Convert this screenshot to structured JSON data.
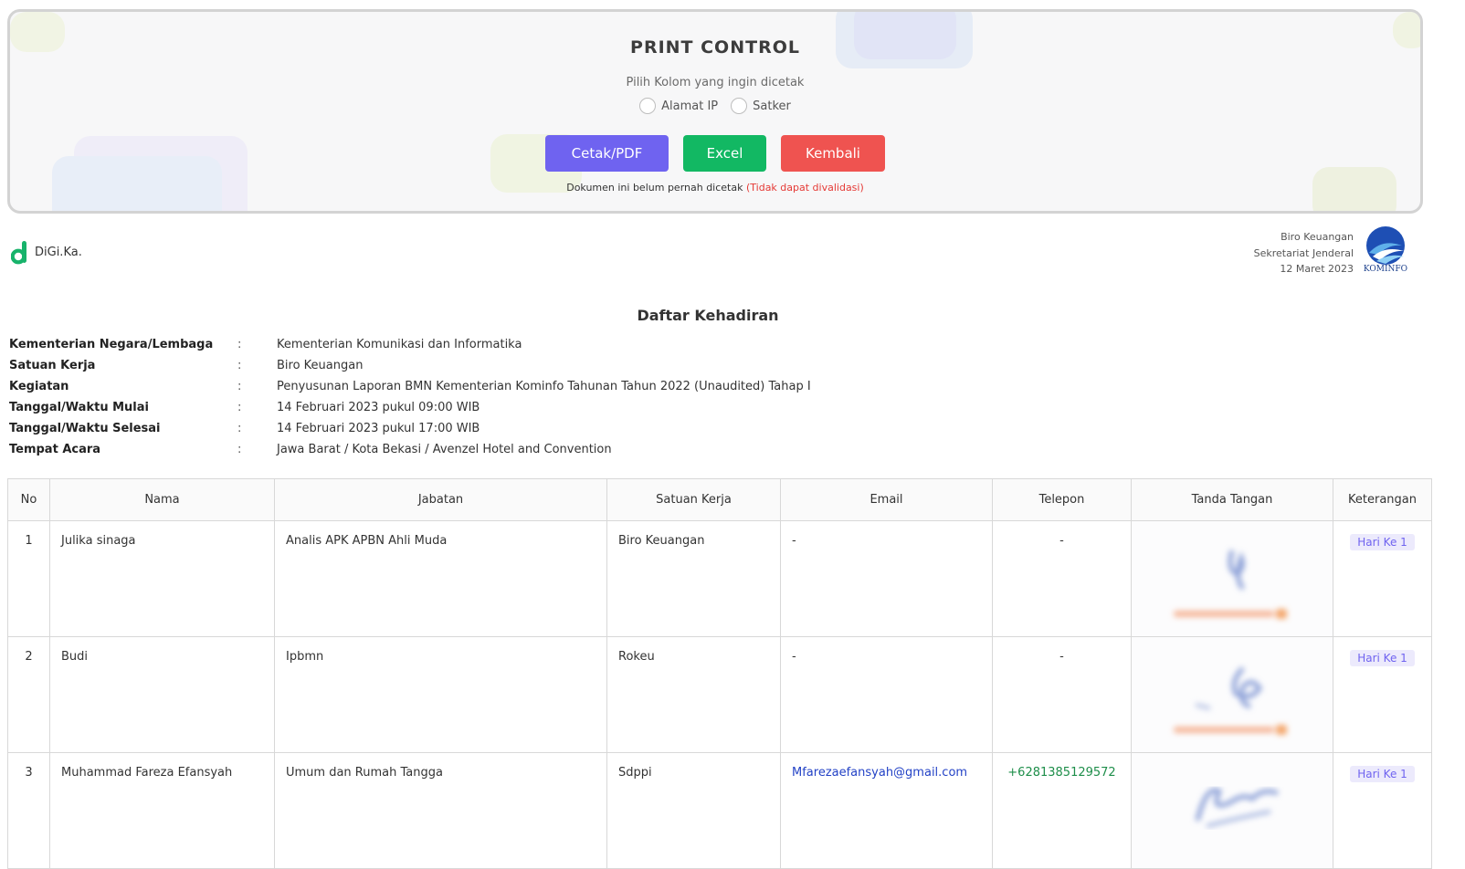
{
  "print_control": {
    "title": "PRINT CONTROL",
    "subtitle": "Pilih Kolom yang ingin dicetak",
    "options": [
      "Alamat IP",
      "Satker"
    ],
    "buttons": {
      "pdf": "Cetak/PDF",
      "excel": "Excel",
      "back": "Kembali"
    },
    "note": "Dokumen ini belum pernah dicetak",
    "note_warning": "(Tidak dapat divalidasi)"
  },
  "brand": {
    "name": "DiGi.Ka."
  },
  "org": {
    "line1": "Biro Keuangan",
    "line2": "Sekretariat Jenderal",
    "date": "12 Maret 2023",
    "logo_text": "KOMINFO"
  },
  "document": {
    "title": "Daftar Kehadiran",
    "info": [
      {
        "label": "Kementerian Negara/Lembaga",
        "value": "Kementerian Komunikasi dan Informatika"
      },
      {
        "label": "Satuan Kerja",
        "value": "Biro Keuangan"
      },
      {
        "label": "Kegiatan",
        "value": "Penyusunan Laporan BMN Kementerian Kominfo Tahunan Tahun 2022 (Unaudited) Tahap I"
      },
      {
        "label": "Tanggal/Waktu Mulai",
        "value": "14 Februari 2023 pukul 09:00 WIB"
      },
      {
        "label": "Tanggal/Waktu Selesai",
        "value": "14 Februari 2023 pukul 17:00 WIB"
      },
      {
        "label": "Tempat Acara",
        "value": "Jawa Barat / Kota Bekasi / Avenzel Hotel and Convention"
      }
    ],
    "colon": ":"
  },
  "table": {
    "headers": [
      "No",
      "Nama",
      "Jabatan",
      "Satuan Kerja",
      "Email",
      "Telepon",
      "Tanda Tangan",
      "Keterangan"
    ],
    "rows": [
      {
        "no": "1",
        "nama": "Julika sinaga",
        "jabatan": "Analis APK APBN Ahli Muda",
        "satker": "Biro Keuangan",
        "email": "-",
        "telepon": "-",
        "keterangan": "Hari Ke 1"
      },
      {
        "no": "2",
        "nama": "Budi",
        "jabatan": "Ipbmn",
        "satker": "Rokeu",
        "email": "-",
        "telepon": "-",
        "keterangan": "Hari Ke 1"
      },
      {
        "no": "3",
        "nama": "Muhammad Fareza Efansyah",
        "jabatan": "Umum dan Rumah Tangga",
        "satker": "Sdppi",
        "email": "Mfarezaefansyah@gmail.com",
        "telepon": "+6281385129572",
        "keterangan": "Hari Ke 1"
      }
    ]
  },
  "colors": {
    "pdf_button": "#6f63f0",
    "excel_button": "#12b863",
    "back_button": "#ef5350",
    "warning": "#e53935",
    "brand_green": "#17b36b",
    "link": "#2342c6",
    "phone": "#1e8e4a"
  }
}
